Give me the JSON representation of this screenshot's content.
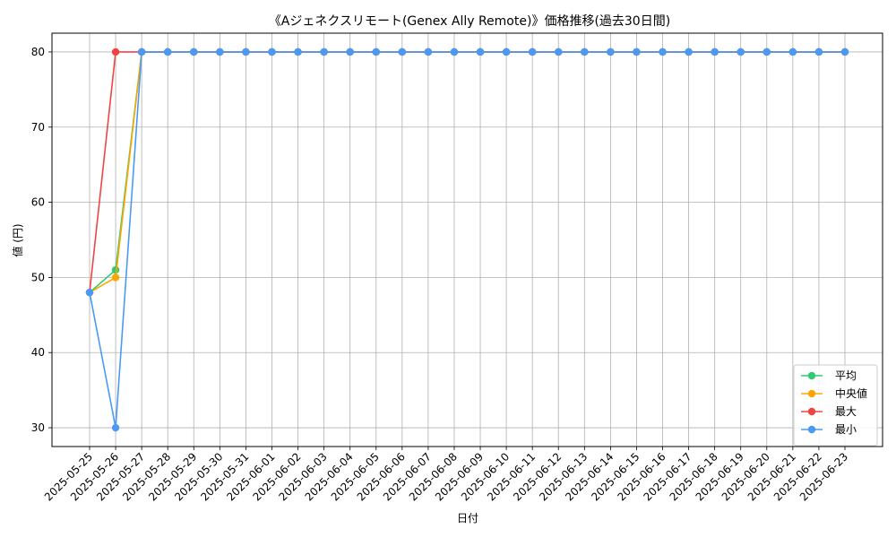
{
  "chart_data": {
    "type": "line",
    "title": "《Aジェネクスリモート(Genex Ally Remote)》価格推移(過去30日間)",
    "xlabel": "日付",
    "ylabel": "値 (円)",
    "ylim": [
      27.5,
      82.5
    ],
    "yticks": [
      30,
      40,
      50,
      60,
      70,
      80
    ],
    "grid": true,
    "legend_position": "lower-right",
    "x": [
      "2025-05-25",
      "2025-05-26",
      "2025-05-27",
      "2025-05-28",
      "2025-05-29",
      "2025-05-30",
      "2025-05-31",
      "2025-06-01",
      "2025-06-02",
      "2025-06-03",
      "2025-06-04",
      "2025-06-05",
      "2025-06-06",
      "2025-06-07",
      "2025-06-08",
      "2025-06-09",
      "2025-06-10",
      "2025-06-11",
      "2025-06-12",
      "2025-06-13",
      "2025-06-14",
      "2025-06-15",
      "2025-06-16",
      "2025-06-17",
      "2025-06-18",
      "2025-06-19",
      "2025-06-20",
      "2025-06-21",
      "2025-06-22",
      "2025-06-23"
    ],
    "series": [
      {
        "name": "平均",
        "color": "#2ecc71",
        "values": [
          48,
          51,
          80,
          80,
          80,
          80,
          80,
          80,
          80,
          80,
          80,
          80,
          80,
          80,
          80,
          80,
          80,
          80,
          80,
          80,
          80,
          80,
          80,
          80,
          80,
          80,
          80,
          80,
          80,
          80
        ]
      },
      {
        "name": "中央値",
        "color": "#ffa500",
        "values": [
          48,
          50,
          80,
          80,
          80,
          80,
          80,
          80,
          80,
          80,
          80,
          80,
          80,
          80,
          80,
          80,
          80,
          80,
          80,
          80,
          80,
          80,
          80,
          80,
          80,
          80,
          80,
          80,
          80,
          80
        ]
      },
      {
        "name": "最大",
        "color": "#ef4444",
        "values": [
          48,
          80,
          80,
          80,
          80,
          80,
          80,
          80,
          80,
          80,
          80,
          80,
          80,
          80,
          80,
          80,
          80,
          80,
          80,
          80,
          80,
          80,
          80,
          80,
          80,
          80,
          80,
          80,
          80,
          80
        ]
      },
      {
        "name": "最小",
        "color": "#4a9af5",
        "values": [
          48,
          30,
          80,
          80,
          80,
          80,
          80,
          80,
          80,
          80,
          80,
          80,
          80,
          80,
          80,
          80,
          80,
          80,
          80,
          80,
          80,
          80,
          80,
          80,
          80,
          80,
          80,
          80,
          80,
          80
        ]
      }
    ]
  }
}
